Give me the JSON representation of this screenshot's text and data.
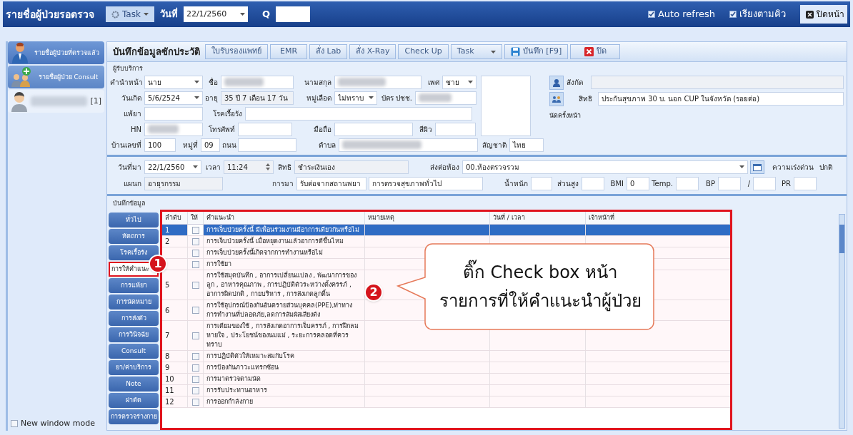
{
  "header": {
    "title": "รายชื่อผู้ป่วยรอตรวจ",
    "task_button": "Task",
    "date_label": "วันที่",
    "date_value": "22/1/2560",
    "q_label": "Q",
    "options": [
      {
        "label": "Auto refresh",
        "checked": true
      },
      {
        "label": "เรียงตามคิว",
        "checked": true
      }
    ],
    "close_button": "ปิดหน้า"
  },
  "sidebar": {
    "items": [
      {
        "label": "รายชื่อผู้ป่วยที่ตรวจแล้ว",
        "kind": "doctor",
        "selected": true
      },
      {
        "label": "รายชื่อผู้ป่วย Consult",
        "kind": "consult",
        "selected": false
      },
      {
        "label": "[1]",
        "kind": "patient",
        "selected": false
      }
    ],
    "new_window": {
      "label": "New window mode",
      "checked": false
    }
  },
  "toolbar": {
    "title": "บันทึกข้อมูลซักประวัติ",
    "buttons": [
      {
        "label": "ใบรับรองแพทย์",
        "kind": "plain"
      },
      {
        "label": "EMR",
        "kind": "plain"
      },
      {
        "label": "สั่ง Lab",
        "kind": "plain"
      },
      {
        "label": "สั่ง X-Ray",
        "kind": "plain"
      },
      {
        "label": "Check Up",
        "kind": "plain"
      },
      {
        "label": "Task",
        "kind": "dropdown"
      },
      {
        "label": "บันทึก [F9]",
        "kind": "save"
      },
      {
        "label": "ปิด",
        "kind": "close"
      }
    ]
  },
  "patient": {
    "section": "ผู้รับบริการ",
    "fields": [
      {
        "label": "คำนำหน้า",
        "value": "นาย",
        "kind": "dropdown"
      },
      {
        "label": "ชื่อ",
        "kind": "blurred"
      },
      {
        "label": "นามสกุล",
        "kind": "blurred"
      },
      {
        "label": "เพศ",
        "value": "ชาย",
        "kind": "dropdown"
      },
      {
        "label": "วันเกิด",
        "value": "5/6/2524",
        "kind": "dropdown"
      },
      {
        "label": "อายุ",
        "value": "35 ปี 7 เดือน 17 วัน",
        "kind": "readonly"
      },
      {
        "label": "หมู่เลือด",
        "value": "ไม่ทราบ",
        "kind": "dropdown"
      },
      {
        "label": "บัตร ปชช.",
        "kind": "blurred"
      },
      {
        "label": "แพ้ยา",
        "kind": "text"
      },
      {
        "label": "โรคเรื้อรัง",
        "kind": "text"
      },
      {
        "label": "HN",
        "kind": "blurred"
      },
      {
        "label": "โทรศัพท์",
        "kind": "text"
      },
      {
        "label": "มือถือ",
        "kind": "text"
      },
      {
        "label": "สีผิว",
        "kind": "text"
      },
      {
        "label": "บ้านเลขที่",
        "value": "100",
        "kind": "text"
      },
      {
        "label": "หมู่ที่",
        "value": "09",
        "kind": "text"
      },
      {
        "label": "ถนน",
        "kind": "text"
      },
      {
        "label": "ตำบล",
        "kind": "blurred"
      }
    ],
    "nationality": {
      "label": "สัญชาติ",
      "value": "ไทย",
      "kind": "text"
    },
    "affiliation": {
      "label": "สังกัด"
    },
    "right": {
      "label": "สิทธิ",
      "value": "ประกันสุขภาพ 30 บ. นอก CUP ในจังหวัด (รอยต่อ)"
    },
    "next_appointment": "นัดครั้งหน้า"
  },
  "visit": {
    "fields": [
      {
        "label": "วันที่มา",
        "value": "22/1/2560",
        "kind": "dropdown"
      },
      {
        "label": "เวลา",
        "value": "11:24",
        "kind": "spinner"
      },
      {
        "label": "สิทธิ",
        "value": "ชำระเงินเอง",
        "kind": "readonly"
      },
      {
        "label": "ส่งต่อห้อง",
        "value": "00.ห้องตรวจรวม",
        "kind": "dropdown"
      },
      {
        "kind": "calendar"
      },
      {
        "label": "ความเร่งด่วน",
        "value": "ปกติ",
        "kind": "plaintext"
      },
      {
        "label": "แผนก",
        "value": "อายุรกรรม",
        "kind": "readonly"
      },
      {
        "label": "การมา",
        "value": "รับต่อจากสถานพยา",
        "kind": "text"
      },
      {
        "value": "การตรวจสุขภาพทั่วไป",
        "kind": "text"
      },
      {
        "label": "น้ำหนัก",
        "kind": "text"
      },
      {
        "label": "ส่วนสูง",
        "kind": "text"
      },
      {
        "label": "BMI",
        "value": "0",
        "kind": "text"
      },
      {
        "label": "Temp.",
        "kind": "text"
      },
      {
        "label": "BP",
        "kind": "text"
      },
      {
        "label": "/",
        "kind": "text"
      },
      {
        "label": "PR",
        "kind": "text"
      }
    ]
  },
  "record": {
    "section": "บันทึกข้อมูล",
    "tabs": [
      {
        "label": "ทั่วไป",
        "selected": false
      },
      {
        "label": "หัตถการ",
        "selected": false
      },
      {
        "label": "โรคเรื้อรัง",
        "selected": false
      },
      {
        "label": "การให้คำแนะ",
        "selected": true
      },
      {
        "label": "การแพ้ยา",
        "selected": false
      },
      {
        "label": "การนัดหมาย",
        "selected": false
      },
      {
        "label": "การส่งตัว",
        "selected": false
      },
      {
        "label": "การวินิจฉัย",
        "selected": false
      },
      {
        "label": "Consult",
        "selected": false
      },
      {
        "label": "ยา/ค่าบริการ",
        "selected": false
      },
      {
        "label": "Note",
        "selected": false
      },
      {
        "label": "ผ่าตัด",
        "selected": false
      },
      {
        "label": "การตรวจร่างกาย",
        "selected": false
      }
    ],
    "table": {
      "columns": [
        "ลำดับ",
        "ให้",
        "คำแนะนำ",
        "หมายเหตุ",
        "วันที่ / เวลา",
        "เจ้าหน้าที่"
      ],
      "rows": [
        {
          "no": "1",
          "advice": "การเจ็บป่วยครั้งนี้ มีเพื่อนร่วมงานมีอาการเดียวกันหรือไม่",
          "checked": false,
          "selected": true
        },
        {
          "no": "2",
          "advice": "การเจ็บป่วยครั้งนี้ เมื่อหยุดงานแล้วอาการดีขึ้นไหม",
          "checked": false,
          "selected": false
        },
        {
          "advice": "การเจ็บป่วยครั้งนี้เกิดจากการทำงานหรือไม่",
          "checked": false,
          "selected": false
        },
        {
          "advice": "การใช้ยา",
          "checked": false,
          "selected": false
        },
        {
          "no": "5",
          "advice": "การใช้สมุดบันทึก , อาการเปลี่ยนแปลง , พัฒนาการของลูก , อาหารคุณภาพ , การปฏิบัติตัวระหว่างตั้งครรภ์ , อาการผิดปกติ , กายบริหาร , การสังเกตลูกดิ้น",
          "checked": false,
          "selected": false
        },
        {
          "no": "6",
          "advice": "การใช้อุปกรณ์ป้องกันอันตรายส่วนบุคคล(PPE),ท่าทางการทำงานที่ปลอดภัย,ลดการสัมผัสเสียงดัง",
          "checked": false,
          "selected": false
        },
        {
          "no": "7",
          "advice": "การเตียมของใช้ , การสังเกตอาการเจ็บครรภ์ , การฝึกลมหายใจ , ประโยชน์ของนมแม่ , ระยะการคลอดที่ควรทราบ",
          "checked": false,
          "selected": false
        },
        {
          "no": "8",
          "advice": "การปฏิบัติตัวให้เหมาะสมกับโรค",
          "checked": false,
          "selected": false
        },
        {
          "no": "9",
          "advice": "การป้องกันภาวะแทรกซ้อน",
          "checked": false,
          "selected": false
        },
        {
          "no": "10",
          "advice": "การมาตรวจตามนัด",
          "checked": false,
          "selected": false
        },
        {
          "no": "11",
          "advice": "การรับประทานอาหาร",
          "checked": false,
          "selected": false
        },
        {
          "no": "12",
          "advice": "การออกกำลังกาย",
          "checked": false,
          "selected": false
        }
      ]
    }
  },
  "annotations": {
    "badges": [
      "1",
      "2"
    ],
    "callout": [
      "ติ๊ก Check box หน้า",
      "รายการที่ให้คำแนะนำผู้ป่วย"
    ]
  }
}
